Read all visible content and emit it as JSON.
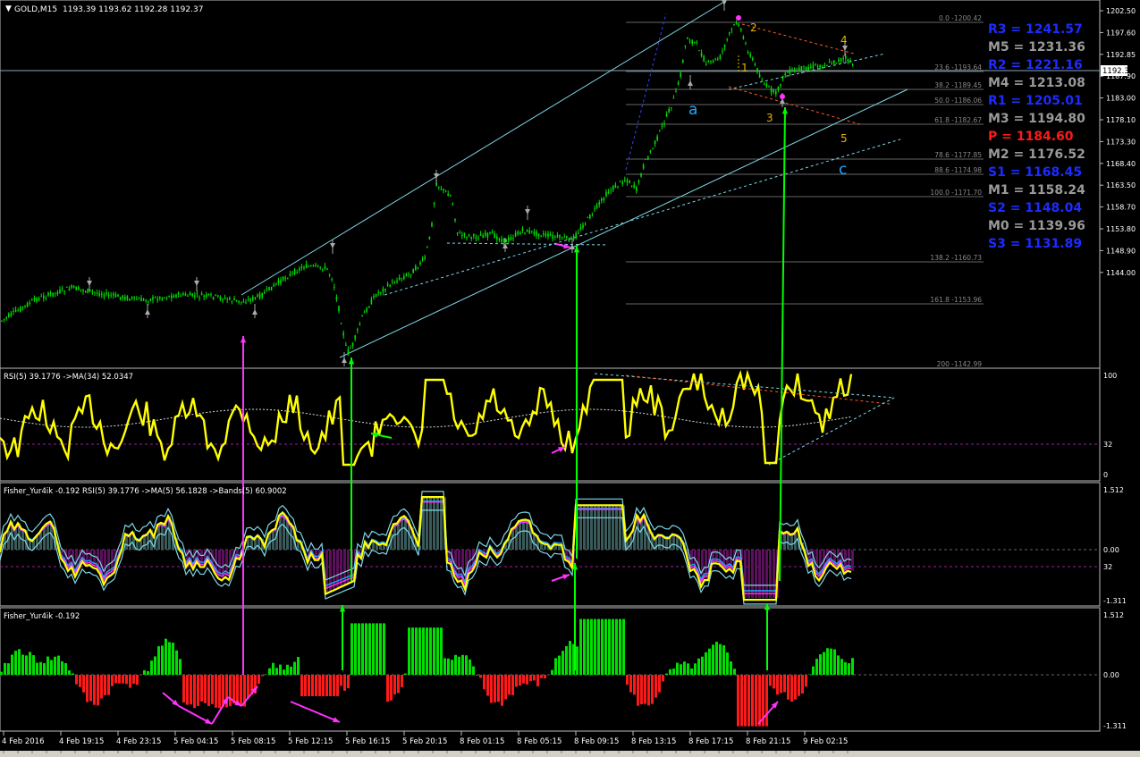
{
  "symbol_header": "GOLD,M15",
  "ohlc": "1193.39 1193.62 1192.28 1192.37",
  "current_price": "1192.37",
  "price_axis": [
    "1202.50",
    "1197.60",
    "1192.85",
    "1187.90",
    "1183.00",
    "1178.10",
    "1173.30",
    "1168.40",
    "1163.50",
    "1158.70",
    "1153.80",
    "1148.90",
    "1144.00"
  ],
  "fib_levels": [
    "0.0 -1200.42",
    "23.6 -1193.64",
    "38.2 -1189.45",
    "50.0 -1186.06",
    "61.8 -1182.67",
    "78.6 -1177.85",
    "88.6 -1174.98",
    "100.0 -1171.70",
    "138.2 -1160.73",
    "161.8 -1153.96",
    "200 -1142.99"
  ],
  "pivots": [
    {
      "label": "R3 = 1241.57",
      "color": "#1c2cff"
    },
    {
      "label": "M5 = 1231.36",
      "color": "#9a9a9a"
    },
    {
      "label": "R2 = 1221.16",
      "color": "#1c2cff"
    },
    {
      "label": "M4 = 1213.08",
      "color": "#9a9a9a"
    },
    {
      "label": "R1 = 1205.01",
      "color": "#1c2cff"
    },
    {
      "label": "M3 = 1194.80",
      "color": "#9a9a9a"
    },
    {
      "label": "P  = 1184.60",
      "color": "#ff1a1a"
    },
    {
      "label": "M2 = 1176.52",
      "color": "#9a9a9a"
    },
    {
      "label": "S1 = 1168.45",
      "color": "#1c2cff"
    },
    {
      "label": "M1 = 1158.24",
      "color": "#9a9a9a"
    },
    {
      "label": "S2 = 1148.04",
      "color": "#1c2cff"
    },
    {
      "label": "M0 = 1139.96",
      "color": "#9a9a9a"
    },
    {
      "label": "S3 = 1131.89",
      "color": "#1c2cff"
    }
  ],
  "wave_labels": {
    "w1": "1",
    "w2": "2",
    "w3": "3",
    "w4": "4",
    "w5": "5",
    "wa": "a",
    "wc": "c"
  },
  "rsi_panel": {
    "title": "RSI(5) 39.1776  ->MA(34) 52.0347",
    "scale": [
      "100",
      "32",
      "0"
    ]
  },
  "fisher_rsi_panel": {
    "title": "Fisher_Yur4ik -0.192 RSI(5) 39.1776  ->MA(5) 56.1828  ->Bands(5) 60.9002",
    "scale": [
      "1.512",
      "0.00",
      "32",
      "-1.311"
    ]
  },
  "fisher_panel": {
    "title": "Fisher_Yur4ik -0.192",
    "scale": [
      "1.512",
      "0.00",
      "-1.311"
    ]
  },
  "time_axis": [
    "4 Feb 2016",
    "4 Feb 19:15",
    "4 Feb 23:15",
    "5 Feb 04:15",
    "5 Feb 08:15",
    "5 Feb 12:15",
    "5 Feb 16:15",
    "5 Feb 20:15",
    "8 Feb 01:15",
    "8 Feb 05:15",
    "8 Feb 09:15",
    "8 Feb 13:15",
    "8 Feb 17:15",
    "8 Feb 21:15",
    "9 Feb 02:15"
  ],
  "colors": {
    "bull": "#00e000",
    "bear": "#ff1a1a",
    "rsi": "#ffff00",
    "channel": "#7fd8e8",
    "arrow_green": "#00ff00",
    "arrow_magenta": "#ff33ff"
  }
}
